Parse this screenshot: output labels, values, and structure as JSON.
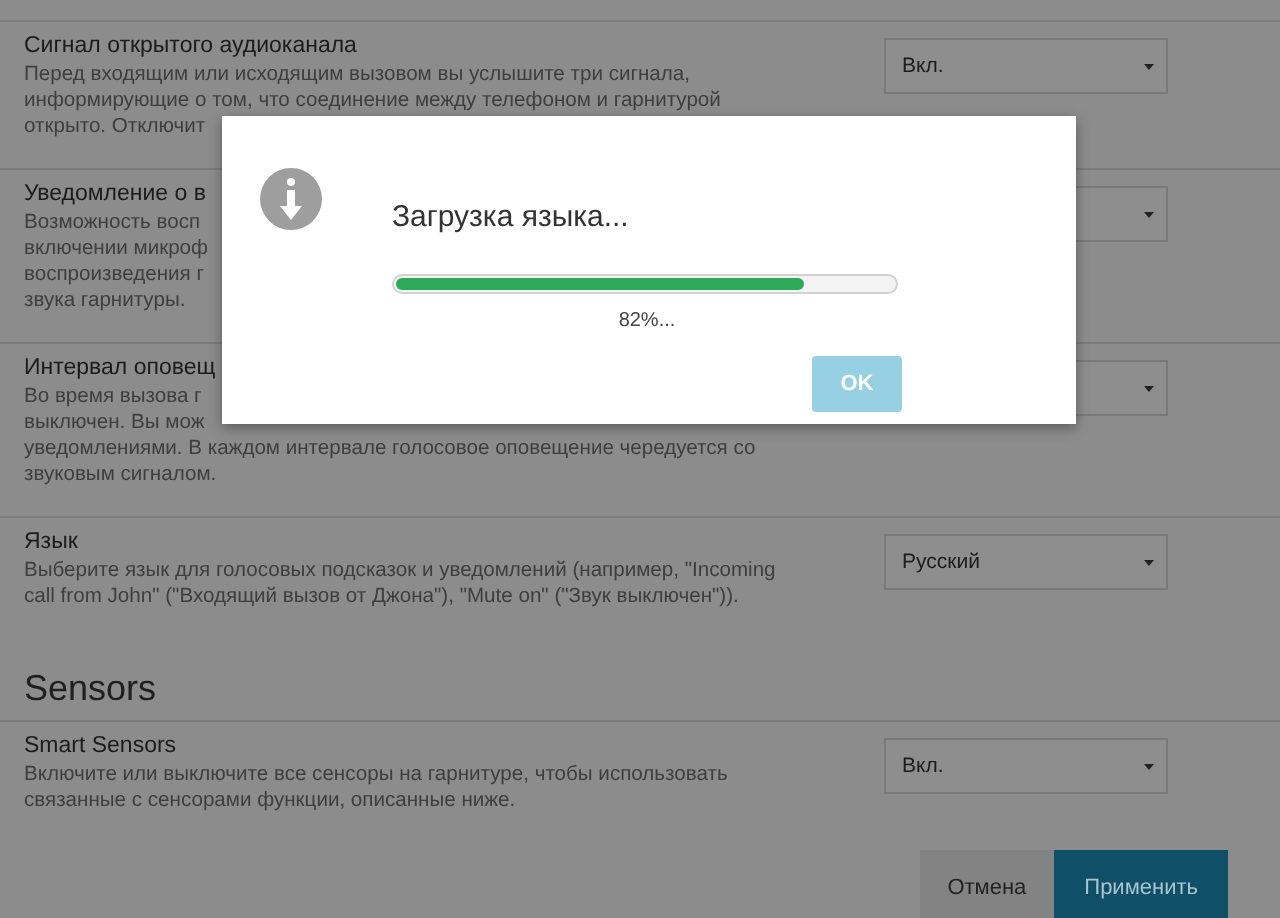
{
  "settings": [
    {
      "title": "Сигнал открытого аудиоканала",
      "description_lines": [
        "Перед входящим или исходящим вызовом вы услышите три сигнала,",
        "информирующие о том, что соединение между телефоном и гарнитурой",
        "открыто. Отключит"
      ],
      "value": "Вкл."
    },
    {
      "title": "Уведомление о в",
      "description_lines": [
        "Возможность восп",
        "включении микроф",
        "воспроизведения г",
        "звука гарнитуры."
      ]
    },
    {
      "title": "Интервал оповещ",
      "description_lines": [
        "Во время вызова г",
        "выключен. Вы мож",
        "уведомлениями. В каждом интервале голосовое оповещение чередуется со",
        "звуковым сигналом."
      ]
    },
    {
      "title": "Язык",
      "description_lines": [
        "Выберите язык для голосовых подсказок и уведомлений (например, \"Incoming",
        "call from John\" (\"Входящий вызов от Джона\"), \"Mute on\" (\"Звук выключен\"))."
      ],
      "value": "Русский"
    }
  ],
  "section_heading": "Sensors",
  "sensor_settings": [
    {
      "title": "Smart Sensors",
      "description_lines": [
        "Включите или выключите все сенсоры на гарнитуре, чтобы использовать",
        "связанные с сенсорами функции, описанные ниже."
      ],
      "value": "Вкл."
    }
  ],
  "buttons": [
    {
      "label": "Отмена",
      "kind": "secondary"
    },
    {
      "label": "Применить",
      "kind": "primary"
    }
  ],
  "dialog": {
    "title": "Загрузка языка...",
    "progress": {
      "level": 0.82
    },
    "percent": "82%...",
    "ok_button": {
      "label": "OK",
      "disabled": true
    }
  }
}
